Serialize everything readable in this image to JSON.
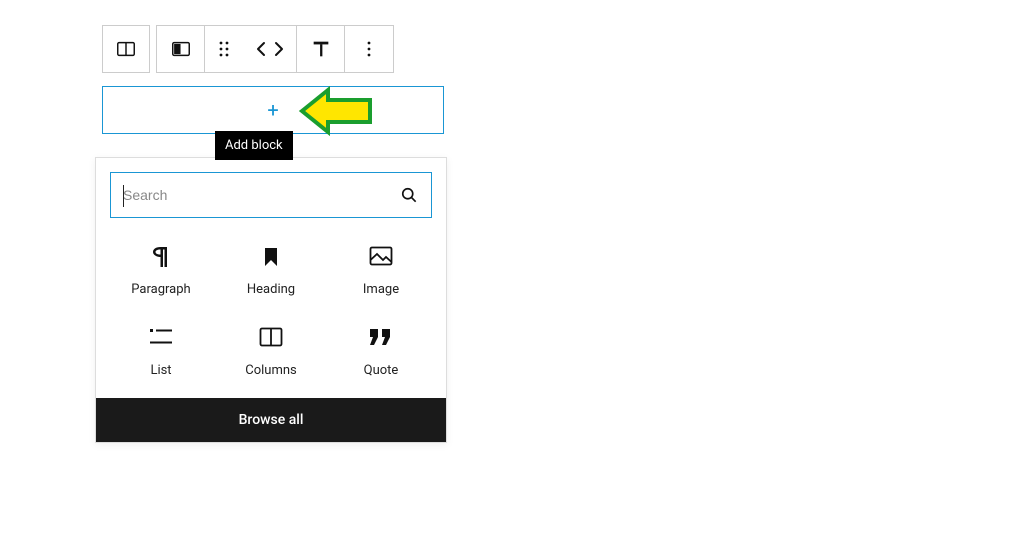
{
  "toolbar": {
    "columns_block": "columns-block",
    "align": "align",
    "drag": "drag",
    "move": "move",
    "row_height": "row-height",
    "more": "more"
  },
  "add_block": {
    "tooltip": "Add block"
  },
  "search": {
    "placeholder": "Search"
  },
  "blocks": [
    {
      "id": "paragraph",
      "label": "Paragraph"
    },
    {
      "id": "heading",
      "label": "Heading"
    },
    {
      "id": "image",
      "label": "Image"
    },
    {
      "id": "list",
      "label": "List"
    },
    {
      "id": "columns",
      "label": "Columns"
    },
    {
      "id": "quote",
      "label": "Quote"
    }
  ],
  "browse_all": "Browse all"
}
